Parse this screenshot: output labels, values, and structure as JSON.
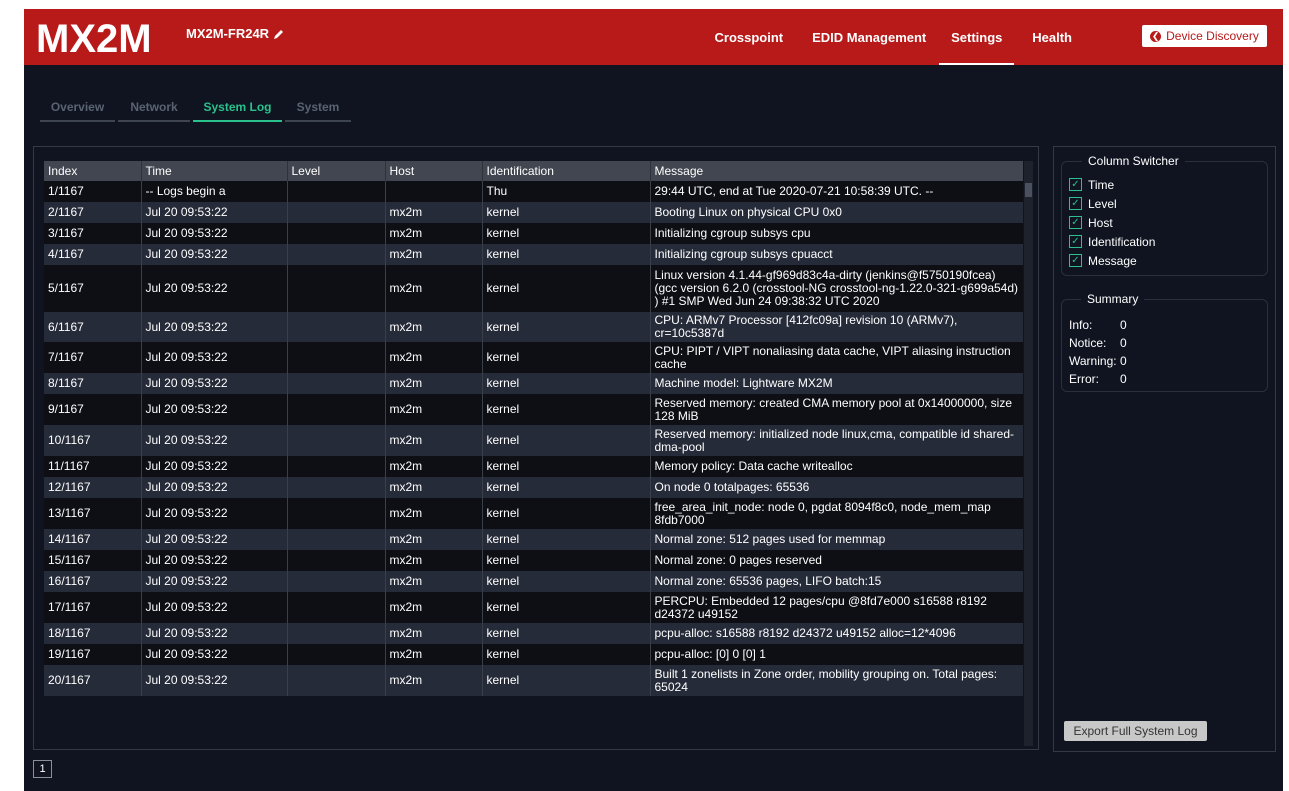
{
  "header": {
    "logo_text": "MX2M",
    "device_name": "MX2M-FR24R",
    "nav": [
      {
        "label": "Crosspoint"
      },
      {
        "label": "EDID Management"
      },
      {
        "label": "Settings"
      },
      {
        "label": "Health"
      }
    ],
    "active_nav": "Settings",
    "discovery_button": "Device Discovery"
  },
  "subtabs": [
    {
      "label": "Overview"
    },
    {
      "label": "Network"
    },
    {
      "label": "System Log"
    },
    {
      "label": "System"
    }
  ],
  "active_subtab": "System Log",
  "log_table": {
    "columns": [
      "Index",
      "Time",
      "Level",
      "Host",
      "Identification",
      "Message"
    ],
    "rows": [
      {
        "index": "1/1167",
        "time": "-- Logs begin a",
        "level": "",
        "host": "",
        "ident": "Thu",
        "message": "29:44 UTC, end at Tue 2020-07-21 10:58:39 UTC. --"
      },
      {
        "index": "2/1167",
        "time": "Jul 20 09:53:22",
        "level": "",
        "host": "mx2m",
        "ident": "kernel",
        "message": "Booting Linux on physical CPU 0x0"
      },
      {
        "index": "3/1167",
        "time": "Jul 20 09:53:22",
        "level": "",
        "host": "mx2m",
        "ident": "kernel",
        "message": "Initializing cgroup subsys cpu"
      },
      {
        "index": "4/1167",
        "time": "Jul 20 09:53:22",
        "level": "",
        "host": "mx2m",
        "ident": "kernel",
        "message": "Initializing cgroup subsys cpuacct"
      },
      {
        "index": "5/1167",
        "time": "Jul 20 09:53:22",
        "level": "",
        "host": "mx2m",
        "ident": "kernel",
        "message": "Linux version 4.1.44-gf969d83c4a-dirty (jenkins@f5750190fcea) (gcc version 6.2.0 (crosstool-NG crosstool-ng-1.22.0-321-g699a54d) ) #1 SMP Wed Jun 24 09:38:32 UTC 2020"
      },
      {
        "index": "6/1167",
        "time": "Jul 20 09:53:22",
        "level": "",
        "host": "mx2m",
        "ident": "kernel",
        "message": "CPU: ARMv7 Processor [412fc09a] revision 10 (ARMv7), cr=10c5387d"
      },
      {
        "index": "7/1167",
        "time": "Jul 20 09:53:22",
        "level": "",
        "host": "mx2m",
        "ident": "kernel",
        "message": "CPU: PIPT / VIPT nonaliasing data cache, VIPT aliasing instruction cache"
      },
      {
        "index": "8/1167",
        "time": "Jul 20 09:53:22",
        "level": "",
        "host": "mx2m",
        "ident": "kernel",
        "message": "Machine model: Lightware MX2M"
      },
      {
        "index": "9/1167",
        "time": "Jul 20 09:53:22",
        "level": "",
        "host": "mx2m",
        "ident": "kernel",
        "message": "Reserved memory: created CMA memory pool at 0x14000000, size 128 MiB"
      },
      {
        "index": "10/1167",
        "time": "Jul 20 09:53:22",
        "level": "",
        "host": "mx2m",
        "ident": "kernel",
        "message": "Reserved memory: initialized node linux,cma, compatible id shared-dma-pool"
      },
      {
        "index": "11/1167",
        "time": "Jul 20 09:53:22",
        "level": "",
        "host": "mx2m",
        "ident": "kernel",
        "message": "Memory policy: Data cache writealloc"
      },
      {
        "index": "12/1167",
        "time": "Jul 20 09:53:22",
        "level": "",
        "host": "mx2m",
        "ident": "kernel",
        "message": "On node 0 totalpages: 65536"
      },
      {
        "index": "13/1167",
        "time": "Jul 20 09:53:22",
        "level": "",
        "host": "mx2m",
        "ident": "kernel",
        "message": "free_area_init_node: node 0, pgdat 8094f8c0, node_mem_map 8fdb7000"
      },
      {
        "index": "14/1167",
        "time": "Jul 20 09:53:22",
        "level": "",
        "host": "mx2m",
        "ident": "kernel",
        "message": "Normal zone: 512 pages used for memmap"
      },
      {
        "index": "15/1167",
        "time": "Jul 20 09:53:22",
        "level": "",
        "host": "mx2m",
        "ident": "kernel",
        "message": "Normal zone: 0 pages reserved"
      },
      {
        "index": "16/1167",
        "time": "Jul 20 09:53:22",
        "level": "",
        "host": "mx2m",
        "ident": "kernel",
        "message": "Normal zone: 65536 pages, LIFO batch:15"
      },
      {
        "index": "17/1167",
        "time": "Jul 20 09:53:22",
        "level": "",
        "host": "mx2m",
        "ident": "kernel",
        "message": "PERCPU: Embedded 12 pages/cpu @8fd7e000 s16588 r8192 d24372 u49152"
      },
      {
        "index": "18/1167",
        "time": "Jul 20 09:53:22",
        "level": "",
        "host": "mx2m",
        "ident": "kernel",
        "message": "pcpu-alloc: s16588 r8192 d24372 u49152 alloc=12*4096"
      },
      {
        "index": "19/1167",
        "time": "Jul 20 09:53:22",
        "level": "",
        "host": "mx2m",
        "ident": "kernel",
        "message": "pcpu-alloc: [0] 0 [0] 1"
      },
      {
        "index": "20/1167",
        "time": "Jul 20 09:53:22",
        "level": "",
        "host": "mx2m",
        "ident": "kernel",
        "message": "Built 1 zonelists in Zone order, mobility grouping on. Total pages: 65024"
      }
    ]
  },
  "column_switcher": {
    "title": "Column Switcher",
    "items": [
      {
        "label": "Time",
        "checked": true
      },
      {
        "label": "Level",
        "checked": true
      },
      {
        "label": "Host",
        "checked": true
      },
      {
        "label": "Identification",
        "checked": true
      },
      {
        "label": "Message",
        "checked": true
      }
    ]
  },
  "summary": {
    "title": "Summary",
    "items": [
      {
        "label": "Info:",
        "value": "0"
      },
      {
        "label": "Notice:",
        "value": "0"
      },
      {
        "label": "Warning:",
        "value": "0"
      },
      {
        "label": "Error:",
        "value": "0"
      }
    ]
  },
  "export_button": "Export Full System Log",
  "pagination": {
    "current_page": "1"
  },
  "colors": {
    "header_red": "#b81a1a",
    "background": "#0f1420",
    "accent_green": "#29c18c"
  }
}
